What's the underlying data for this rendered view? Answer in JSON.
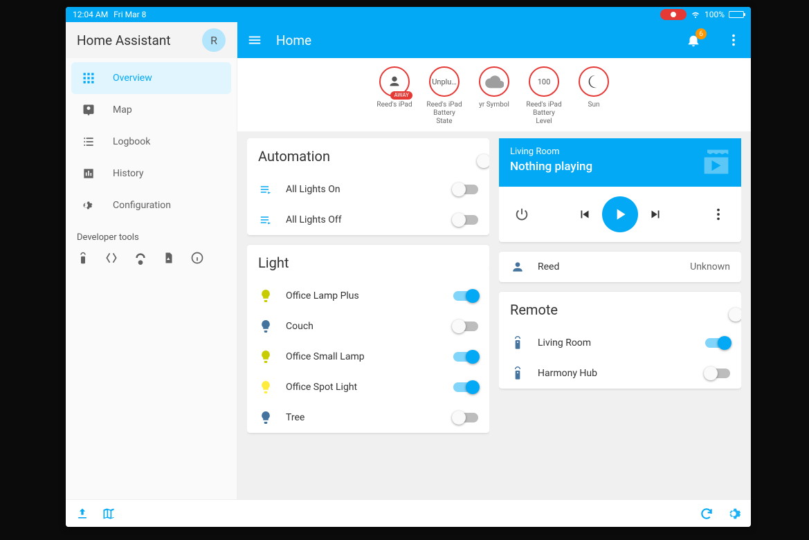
{
  "statusbar": {
    "time": "12:04 AM",
    "date": "Fri Mar 8",
    "battery": "100%"
  },
  "sidebar": {
    "title": "Home Assistant",
    "avatar": "R",
    "items": [
      {
        "label": "Overview",
        "icon": "grid",
        "active": true
      },
      {
        "label": "Map",
        "icon": "person-pin"
      },
      {
        "label": "Logbook",
        "icon": "list"
      },
      {
        "label": "History",
        "icon": "chart"
      },
      {
        "label": "Configuration",
        "icon": "gear"
      }
    ],
    "dev_title": "Developer tools"
  },
  "topbar": {
    "title": "Home",
    "badge": "6"
  },
  "glance": [
    {
      "label": "Reed's iPad",
      "icon": "person",
      "badge": "AWAY"
    },
    {
      "label": "Reed's iPad Battery State",
      "text": "Unplu…"
    },
    {
      "label": "yr Symbol",
      "icon": "cloud"
    },
    {
      "label": "Reed's iPad Battery Level",
      "text": "100",
      "badge": "%"
    },
    {
      "label": "Sun",
      "icon": "moon"
    }
  ],
  "automation": {
    "title": "Automation",
    "master": false,
    "rows": [
      {
        "label": "All Lights On",
        "on": false
      },
      {
        "label": "All Lights Off",
        "on": false
      }
    ]
  },
  "light": {
    "title": "Light",
    "master": true,
    "rows": [
      {
        "label": "Office Lamp Plus",
        "on": true,
        "color": "on"
      },
      {
        "label": "Couch",
        "on": false,
        "color": "off"
      },
      {
        "label": "Office Small Lamp",
        "on": true,
        "color": "on"
      },
      {
        "label": "Office Spot Light",
        "on": true,
        "color": "spot"
      },
      {
        "label": "Tree",
        "on": false,
        "color": "off"
      }
    ]
  },
  "media": {
    "room": "Living Room",
    "state": "Nothing playing"
  },
  "person": {
    "name": "Reed",
    "state": "Unknown"
  },
  "remote": {
    "title": "Remote",
    "master": false,
    "rows": [
      {
        "label": "Living Room",
        "on": true
      },
      {
        "label": "Harmony Hub",
        "on": false
      }
    ]
  }
}
